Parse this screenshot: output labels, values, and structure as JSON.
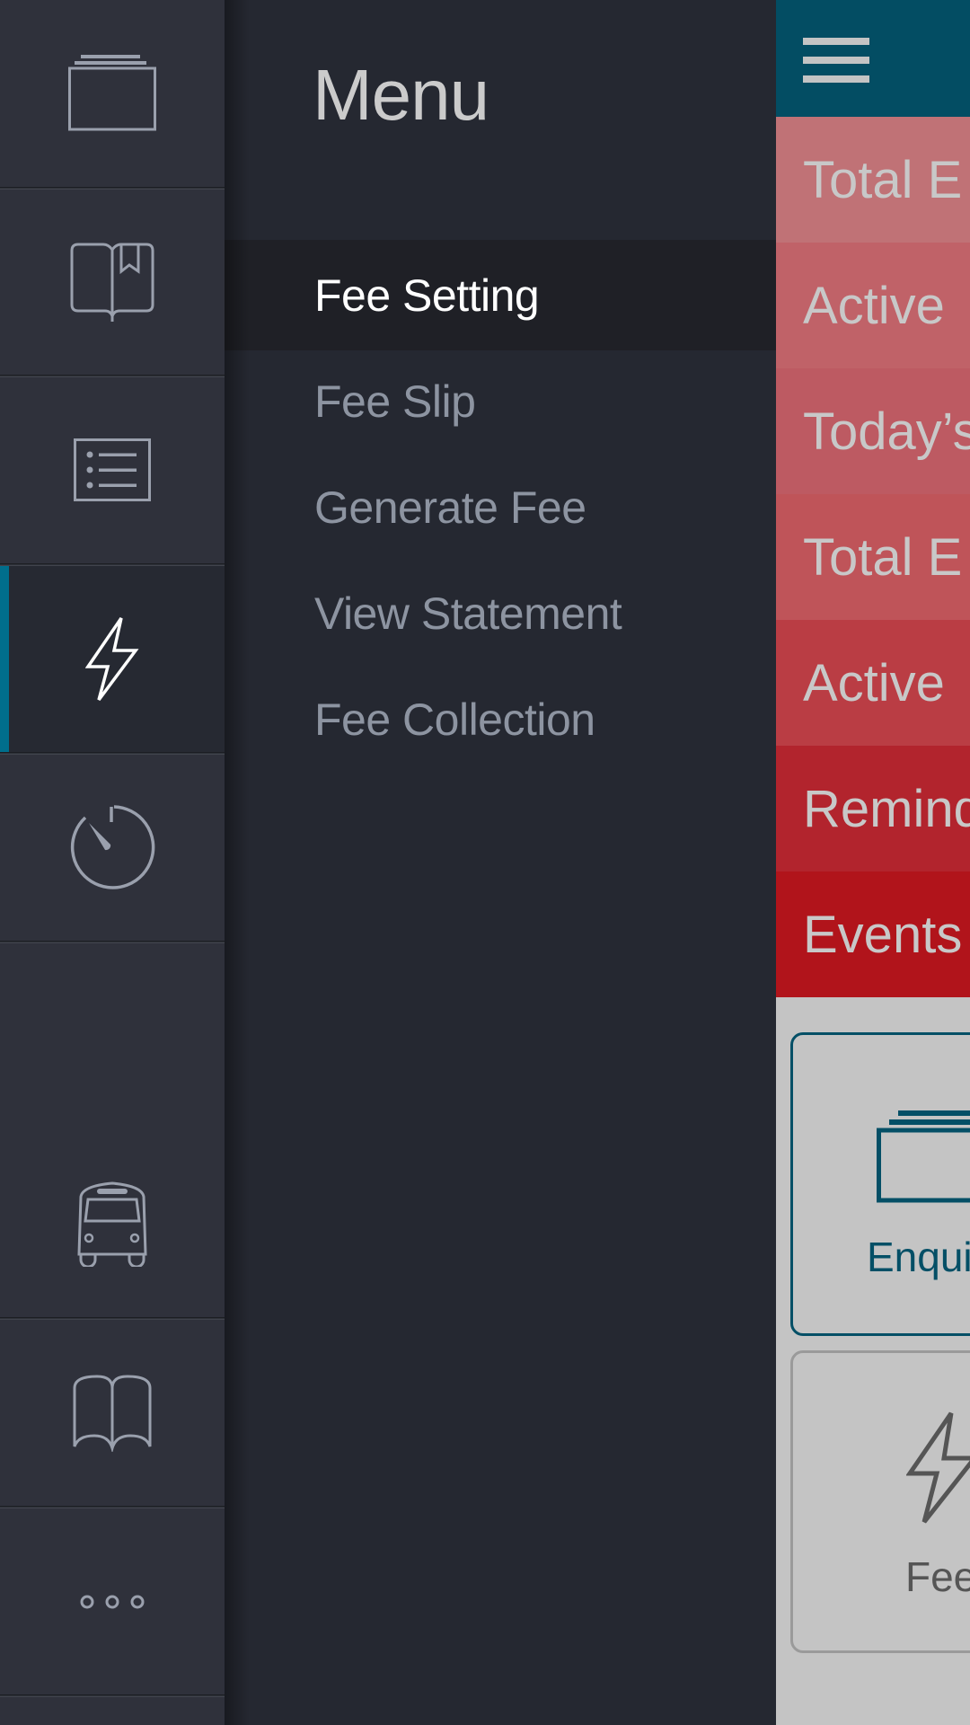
{
  "sidebar": {
    "items": [
      {
        "id": "enquiry",
        "icon": "folder-stack-icon",
        "active": false
      },
      {
        "id": "book",
        "icon": "open-book-bookmark-icon",
        "active": false
      },
      {
        "id": "list",
        "icon": "list-icon",
        "active": false
      },
      {
        "id": "fee",
        "icon": "lightning-bolt-icon",
        "active": true
      },
      {
        "id": "timer",
        "icon": "stopwatch-icon",
        "active": false
      },
      {
        "id": "transport",
        "icon": "bus-icon",
        "active": false
      },
      {
        "id": "library",
        "icon": "open-book-icon",
        "active": false
      },
      {
        "id": "more",
        "icon": "more-dots-icon",
        "active": false
      }
    ],
    "accent_color": "#006e8c"
  },
  "menu": {
    "title": "Menu",
    "items": [
      {
        "label": "Fee Setting",
        "selected": true
      },
      {
        "label": "Fee Slip",
        "selected": false
      },
      {
        "label": "Generate Fee",
        "selected": false
      },
      {
        "label": "View Statement",
        "selected": false
      },
      {
        "label": "Fee Collection",
        "selected": false
      }
    ]
  },
  "content": {
    "header_color": "#034d63",
    "menu_button_icon": "hamburger-icon",
    "stats": [
      {
        "label": "Total E",
        "color": "#c07276"
      },
      {
        "label": "Active",
        "color": "#c06268"
      },
      {
        "label": "Today’s",
        "color": "#bd5a62"
      },
      {
        "label": "Total E",
        "color": "#bf5459"
      },
      {
        "label": "Active",
        "color": "#ba3d44"
      },
      {
        "label": "Remind",
        "color": "#b2242d"
      },
      {
        "label": "Events",
        "color": "#b1141b"
      }
    ],
    "cards": [
      {
        "label": "Enqui",
        "icon": "folder-stack-icon",
        "color": "#044f66",
        "border": "#044f66"
      },
      {
        "label": "Fee",
        "icon": "lightning-bolt-icon",
        "color": "#555555",
        "border": "#9a9a9a"
      }
    ]
  }
}
